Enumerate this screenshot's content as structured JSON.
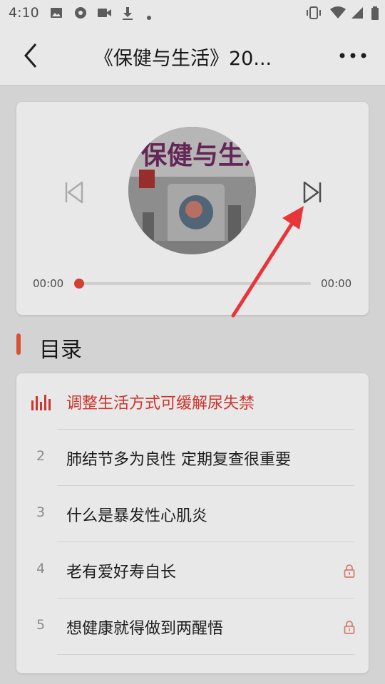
{
  "status_bar": {
    "time": "4:10",
    "left_icons": [
      "image-icon",
      "disc-icon",
      "video-icon",
      "download-icon",
      "dot-icon"
    ],
    "right_icons": [
      "vibrate-icon",
      "wifi-icon",
      "signal-icon",
      "battery-icon"
    ]
  },
  "header": {
    "title": "《保健与生活》20..."
  },
  "player": {
    "current_time": "00:00",
    "total_time": "00:00",
    "progress": 0
  },
  "toc": {
    "title": "目录",
    "items": [
      {
        "number": "",
        "title": "调整生活方式可缓解尿失禁",
        "playing": true,
        "locked": false
      },
      {
        "number": "2",
        "title": "肺结节多为良性 定期复查很重要",
        "playing": false,
        "locked": false
      },
      {
        "number": "3",
        "title": "什么是暴发性心肌炎",
        "playing": false,
        "locked": false
      },
      {
        "number": "4",
        "title": "老有爱好寿自长",
        "playing": false,
        "locked": true
      },
      {
        "number": "5",
        "title": "想健康就得做到两醒悟",
        "playing": false,
        "locked": true
      }
    ]
  },
  "colors": {
    "accent": "#e23b32",
    "section_bar": "#ee5a3c",
    "annotation_arrow": "#e8353a"
  }
}
